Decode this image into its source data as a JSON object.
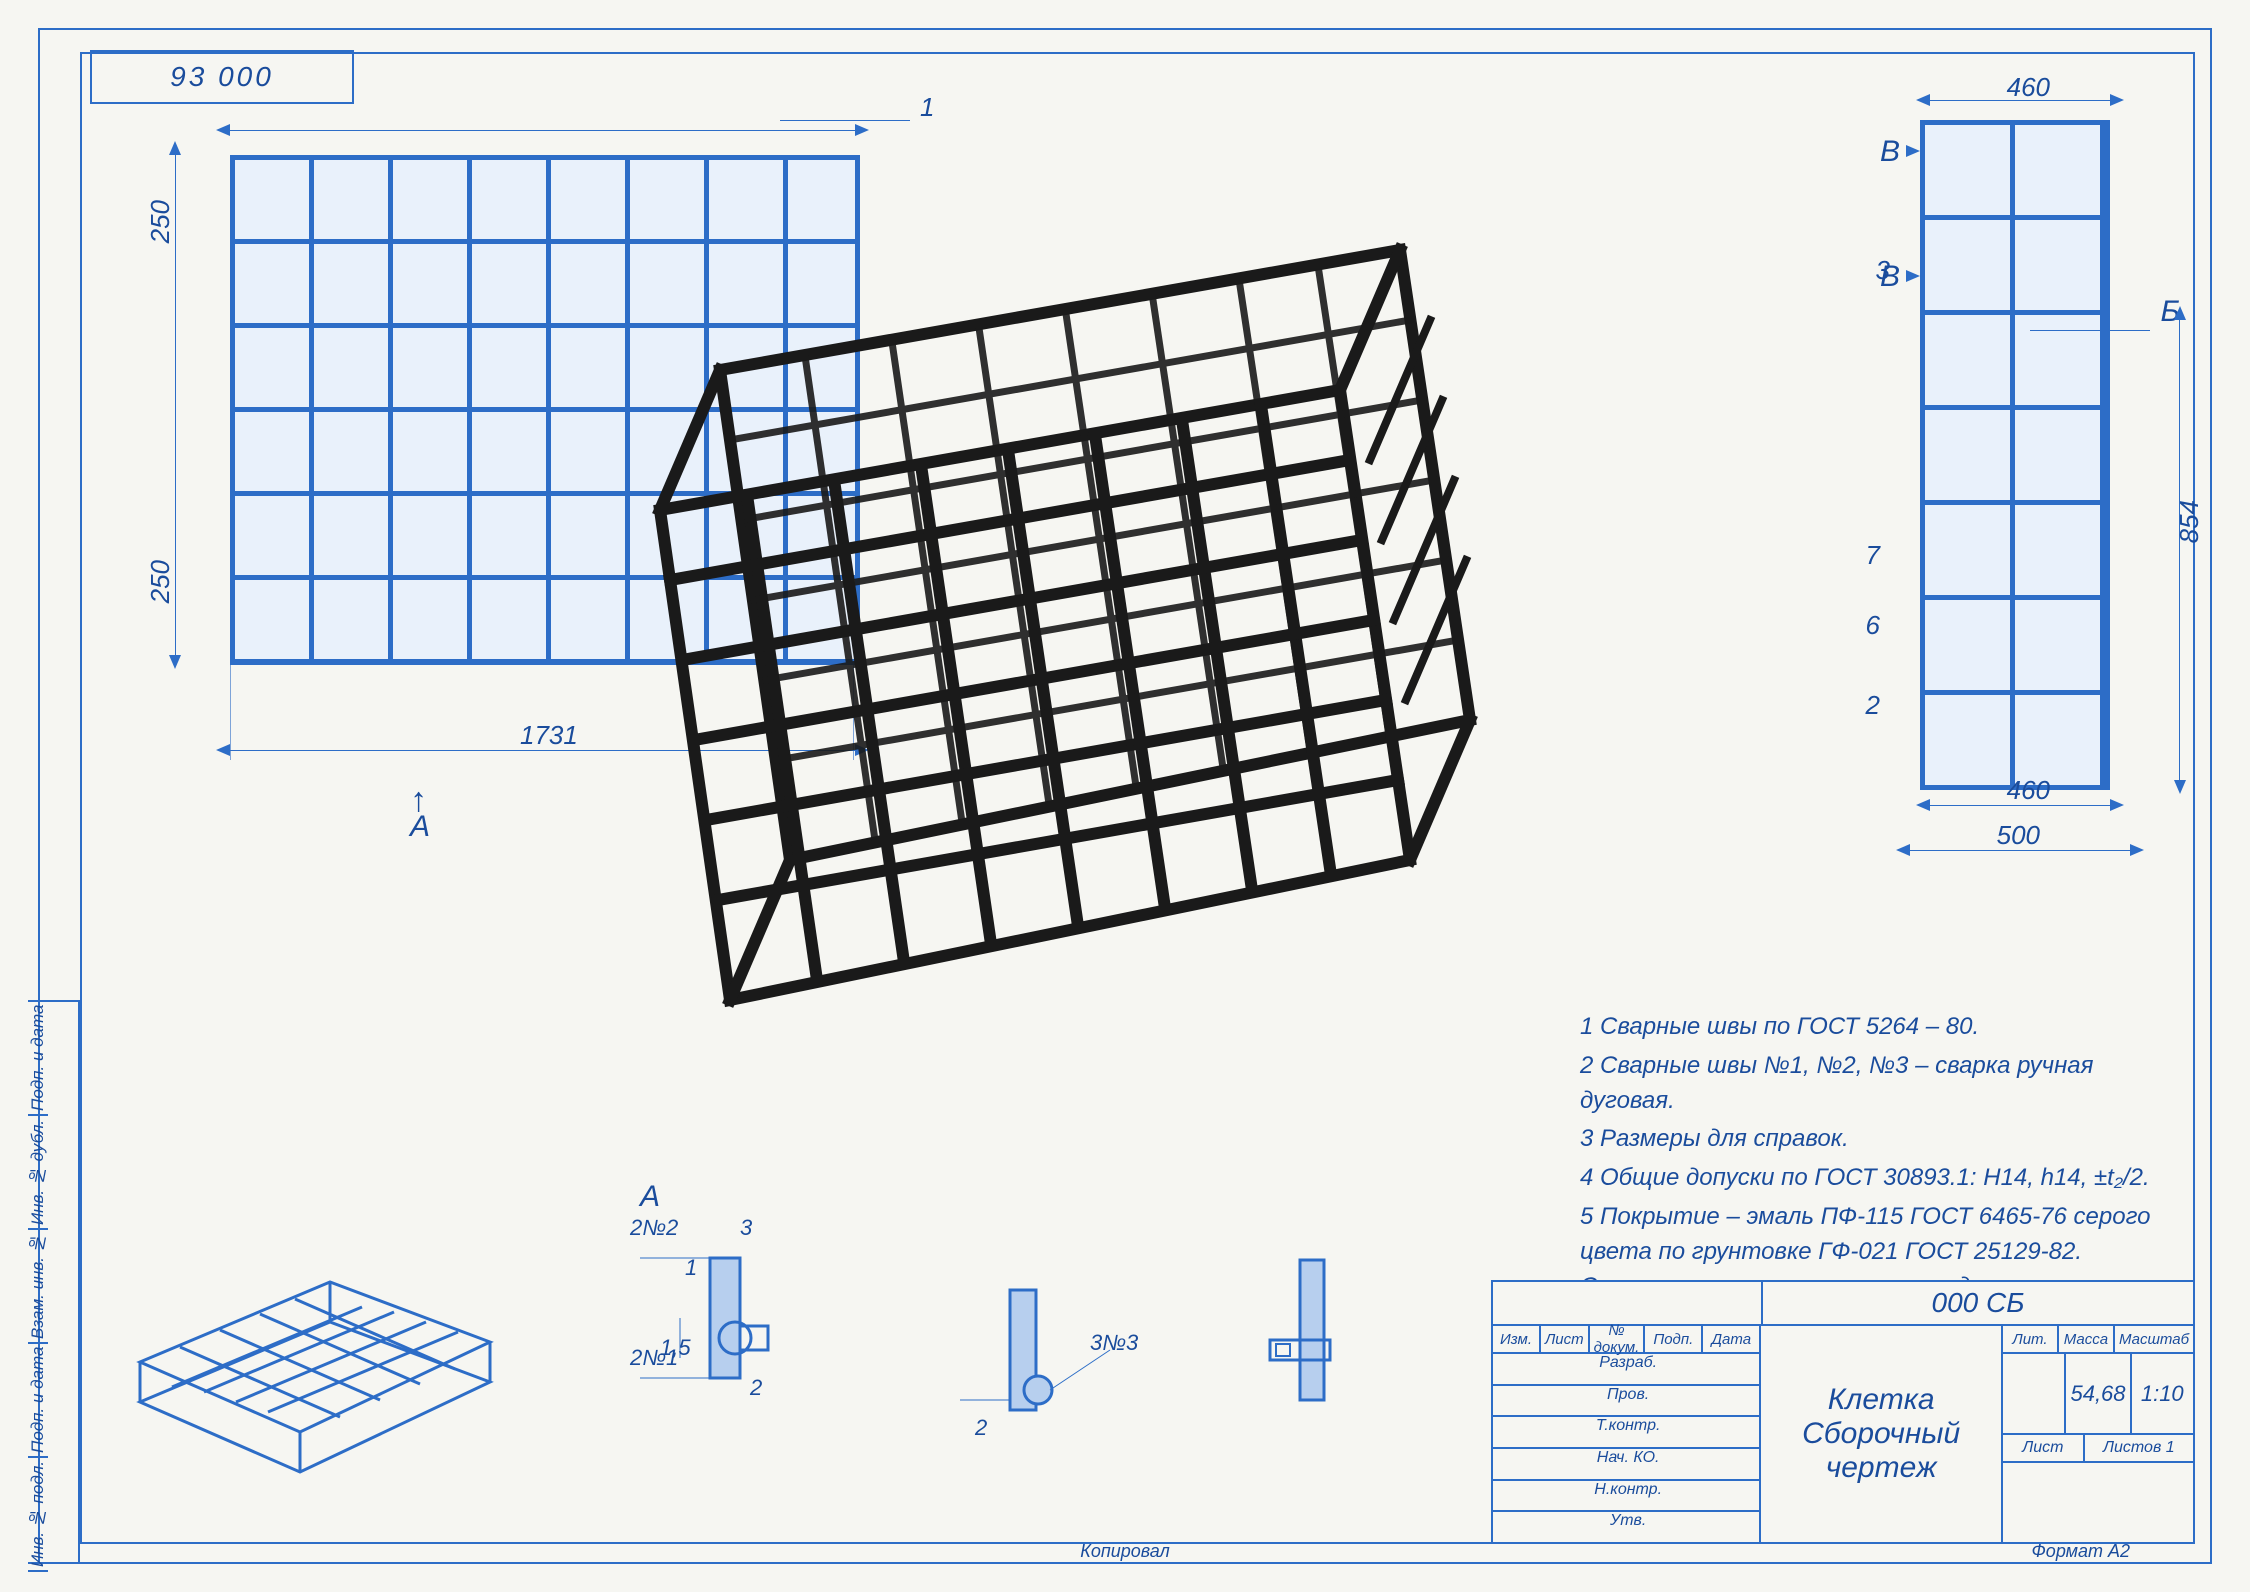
{
  "drawing_no": "93 000",
  "front_view": {
    "balloon": "1",
    "dims": {
      "overall_w": "1731",
      "cell_h1": "250",
      "cell_h2": "250"
    },
    "section_arrow": "А"
  },
  "side_view": {
    "callouts": {
      "B": "В",
      "B2": "В",
      "b_label": "Б"
    },
    "balloons": [
      "3",
      "7",
      "6",
      "2"
    ],
    "dims": {
      "top_w": "460",
      "bot_w": "460",
      "overall_w": "500",
      "height": "854"
    }
  },
  "detail_A": {
    "title": "А",
    "dims": [
      "1",
      "2",
      "1,5"
    ],
    "weld": [
      "2№2",
      "2№1",
      "3"
    ],
    "callouts": [
      "1",
      "2"
    ]
  },
  "detail_B": {
    "weld": "3№3",
    "dim": "2"
  },
  "notes": [
    "1 Сварные швы по ГОСТ 5264 – 80.",
    "2 Сварные швы №1, №2, №3 – сварка ручная дуговая.",
    "3 Размеры для справок.",
    "4 Общие допуски по ГОСТ 30893.1: H14, h14, ±t₂/2.",
    "5 Покрытие – эмаль ПФ-115   ГОСТ 6465-76 серого цвета по грунтовке ГФ-021 ГОСТ 25129-82. Окрашиваемые поверхности предварительно очистить от грязи, ржавчины, шлака, масла."
  ],
  "titleblock": {
    "code": "000 СБ",
    "name1": "Клетка",
    "name2": "Сборочный чертеж",
    "cols": [
      "Изм.",
      "Лист",
      "№ докум.",
      "Подп.",
      "Дата"
    ],
    "rows": [
      "Разраб.",
      "Пров.",
      "Т.контр.",
      "Нач. КО.",
      "Н.контр.",
      "Утв."
    ],
    "lit": "Лит.",
    "mass": "Масса",
    "scale": "Масштаб",
    "mass_v": "54,68",
    "scale_v": "1:10",
    "sheet": "Лист",
    "sheets": "Листов   1",
    "format": "Формат   А2"
  },
  "revstrip": [
    "Инв. № подл.",
    "Подп. и дата",
    "Взам. инв. №",
    "Инв. № дубл.",
    "Подп. и дата"
  ],
  "footer": {
    "copy": "Копировал",
    "format": "Формат   А2"
  }
}
